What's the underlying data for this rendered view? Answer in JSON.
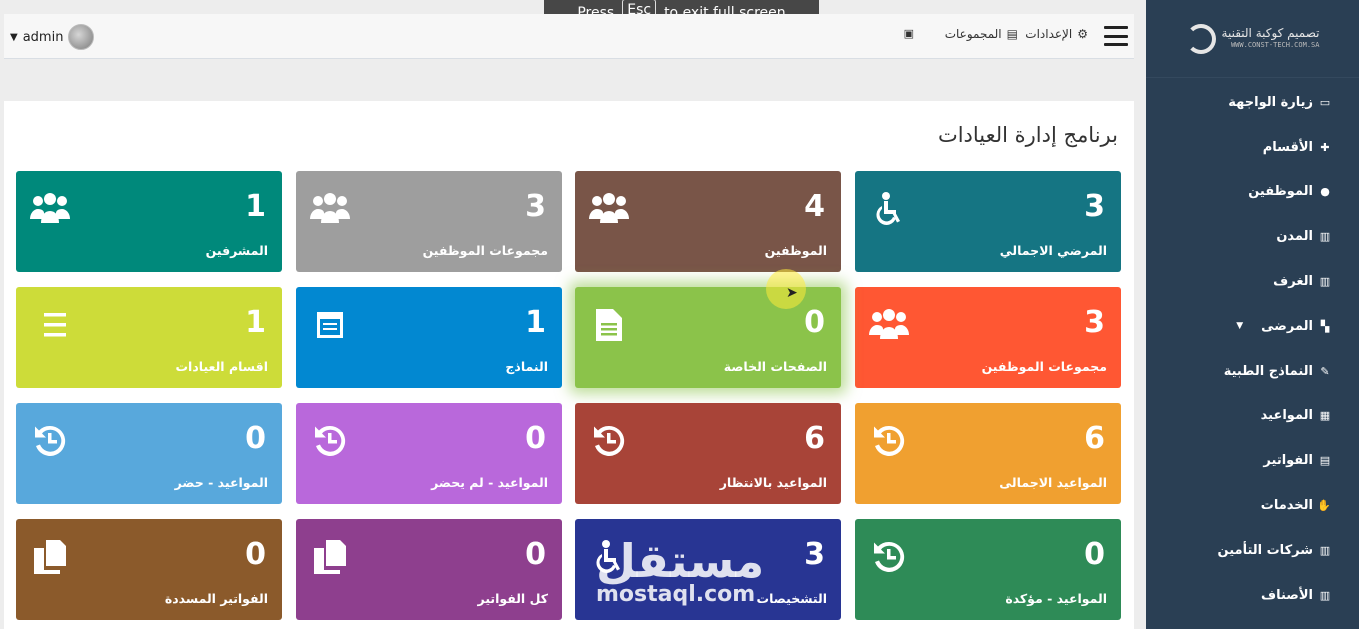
{
  "overlay": {
    "press": "Press",
    "key": "Esc",
    "rest": "to exit full screen"
  },
  "sidebar": {
    "brand_name": "تصميم كوكبة التقنية",
    "brand_url": "WWW.CONST-TECH.COM.SA",
    "items": [
      {
        "label": "زيارة الواجهة",
        "icon": "monitor-icon"
      },
      {
        "label": "الأقسام",
        "icon": "puzzle-icon"
      },
      {
        "label": "الموظفين",
        "icon": "user-icon"
      },
      {
        "label": "المدن",
        "icon": "building-icon"
      },
      {
        "label": "الغرف",
        "icon": "building-icon"
      },
      {
        "label": "المرضى",
        "icon": "patient-icon",
        "has_submenu": true
      },
      {
        "label": "النماذج الطبية",
        "icon": "form-icon"
      },
      {
        "label": "المواعيد",
        "icon": "calendar-icon"
      },
      {
        "label": "الفواتير",
        "icon": "file-icon"
      },
      {
        "label": "الخدمات",
        "icon": "handshake-icon"
      },
      {
        "label": "شركات التأمين",
        "icon": "building-icon"
      },
      {
        "label": "الأصناف",
        "icon": "building-icon"
      }
    ]
  },
  "topbar": {
    "settings": "الإعدادات",
    "groups": "المجموعات",
    "user": "admin"
  },
  "page_title": "برنامج إدارة العيادات",
  "tiles": [
    {
      "value": "3",
      "label": "المرضي الاجمالي",
      "icon": "wheelchair-icon",
      "color": "#157583"
    },
    {
      "value": "4",
      "label": "الموظفين",
      "icon": "users-icon",
      "color": "#795548"
    },
    {
      "value": "3",
      "label": "مجموعات الموظفين",
      "icon": "users-icon",
      "color": "#9e9e9e"
    },
    {
      "value": "1",
      "label": "المشرفين",
      "icon": "users-icon",
      "color": "#00897b"
    },
    {
      "value": "3",
      "label": "مجموعات الموظفين",
      "icon": "users-icon",
      "color": "#ff5733"
    },
    {
      "value": "0",
      "label": "الصفحات الخاصة",
      "icon": "document-icon",
      "color": "#8bc34a"
    },
    {
      "value": "1",
      "label": "النماذج",
      "icon": "form-icon",
      "color": "#0288d1"
    },
    {
      "value": "1",
      "label": "اقسام العيادات",
      "icon": "ordered-list-icon",
      "color": "#cddc39"
    },
    {
      "value": "6",
      "label": "المواعيد الاجمالى",
      "icon": "history-icon",
      "color": "#f0a030"
    },
    {
      "value": "6",
      "label": "المواعيد بالانتظار",
      "icon": "history-icon",
      "color": "#a84438"
    },
    {
      "value": "0",
      "label": "المواعيد - لم يحضر",
      "icon": "history-icon",
      "color": "#b968db"
    },
    {
      "value": "0",
      "label": "المواعيد - حضر",
      "icon": "history-icon",
      "color": "#58a8dc"
    },
    {
      "value": "0",
      "label": "المواعيد - مؤكدة",
      "icon": "history-icon",
      "color": "#2e8b57"
    },
    {
      "value": "3",
      "label": "التشخيصات",
      "icon": "wheelchair-icon",
      "color": "#283593"
    },
    {
      "value": "0",
      "label": "كل الفواتير",
      "icon": "copy-icon",
      "color": "#8e3f8e"
    },
    {
      "value": "0",
      "label": "الفواتير المسددة",
      "icon": "copy-icon",
      "color": "#8b5a2b"
    }
  ],
  "watermark": {
    "arabic": "مستقل",
    "latin": "mostaql.com"
  }
}
